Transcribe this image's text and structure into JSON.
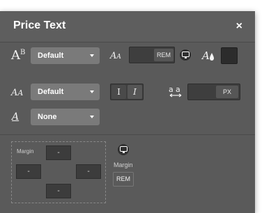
{
  "panel": {
    "title": "Price Text",
    "close_label": "×"
  },
  "rows": {
    "font_family": {
      "value": "Default"
    },
    "font_weight": {
      "value": "Default"
    },
    "text_decoration": {
      "value": "None"
    },
    "font_size_unit": "REM",
    "letter_spacing_unit": "PX",
    "italic_normal_label": "I",
    "italic_slant_label": "I"
  },
  "spacing": {
    "margin_label": "Margin",
    "top": "-",
    "left": "-",
    "right": "-",
    "bottom": "-",
    "unit_title": "Margin",
    "unit": "REM"
  },
  "colors": {
    "panel_bg": "#5a5a5a",
    "text_color_swatch": "#2c2c2c"
  },
  "icons": {
    "font_family": "font-family-icon",
    "font_weight": "font-weight-icon",
    "text_decoration": "text-underline-icon",
    "font_size": "font-size-icon",
    "responsive": "monitor-icon",
    "text_color": "color-drop-icon",
    "letter_spacing": "letter-spacing-icon"
  }
}
